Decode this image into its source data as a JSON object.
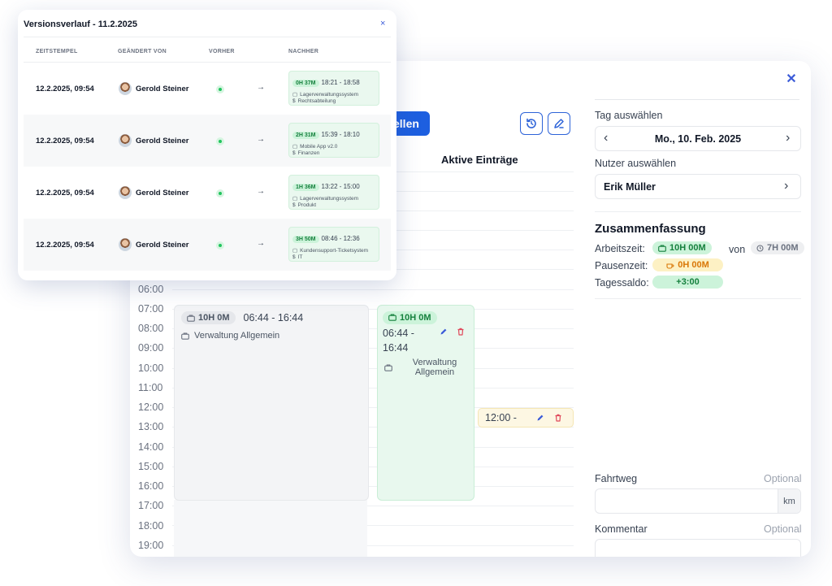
{
  "popup": {
    "title": "Versionsverlauf - 11.2.2025",
    "close_symbol": "×",
    "headers": {
      "timestamp": "ZEITSTEMPEL",
      "changed_by": "GEÄNDERT VON",
      "before": "VORHER",
      "after": "NACHHER"
    },
    "rows": [
      {
        "timestamp": "12.2.2025, 09:54",
        "user": "Gerold Steiner",
        "arrow": "→",
        "duration": "0H 37M",
        "range": "18:21 - 18:58",
        "project": "Lagerverwaltungssystem",
        "department": "Rechtsabteilung"
      },
      {
        "timestamp": "12.2.2025, 09:54",
        "user": "Gerold Steiner",
        "arrow": "→",
        "duration": "2H 31M",
        "range": "15:39 - 18:10",
        "project": "Mobile App v2.0",
        "department": "Finanzen"
      },
      {
        "timestamp": "12.2.2025, 09:54",
        "user": "Gerold Steiner",
        "arrow": "→",
        "duration": "1H 36M",
        "range": "13:22 - 15:00",
        "project": "Lagerverwaltungssystem",
        "department": "Produkt"
      },
      {
        "timestamp": "12.2.2025, 09:54",
        "user": "Gerold Steiner",
        "arrow": "→",
        "duration": "3H 50M",
        "range": "08:46 - 12:36",
        "project": "Kundensupport-Ticketsystem",
        "department": "IT"
      }
    ]
  },
  "main": {
    "close_symbol": "✕",
    "primary_button_label": "ellen",
    "active_entries_title": "Aktive Einträge",
    "times": [
      "06:00",
      "07:00",
      "08:00",
      "09:00",
      "10:00",
      "11:00",
      "12:00",
      "13:00",
      "14:00",
      "15:00",
      "16:00",
      "17:00",
      "18:00",
      "19:00"
    ],
    "entry_gray": {
      "duration": "10H 0M",
      "range": "06:44 - 16:44",
      "project": "Verwaltung Allgemein"
    },
    "entry_green": {
      "duration": "10H 0M",
      "range_start": "06:44 -",
      "range_end": "16:44",
      "project_line1": "Verwaltung",
      "project_line2": "Allgemein"
    },
    "entry_yellow": {
      "range": "12:00 -"
    }
  },
  "right_panel": {
    "day_label": "Tag auswählen",
    "day_value": "Mo., 10. Feb. 2025",
    "prev_symbol": "‹",
    "next_symbol": "›",
    "user_label": "Nutzer auswählen",
    "user_value": "Erik Müller",
    "summary_title": "Zusammenfassung",
    "work_label": "Arbeitszeit:",
    "work_value": "10H 00M",
    "of_label": "von",
    "target_value": "7H 00M",
    "break_label": "Pausenzeit:",
    "break_value": "0H 00M",
    "balance_label": "Tagessaldo:",
    "balance_value": "+3:00",
    "route_label": "Fahrtweg",
    "route_optional": "Optional",
    "route_unit": "km",
    "comment_label": "Kommentar",
    "comment_optional": "Optional"
  },
  "colors": {
    "accent": "#1d5fe0",
    "green": "#15803d",
    "yellow": "#d97706"
  }
}
